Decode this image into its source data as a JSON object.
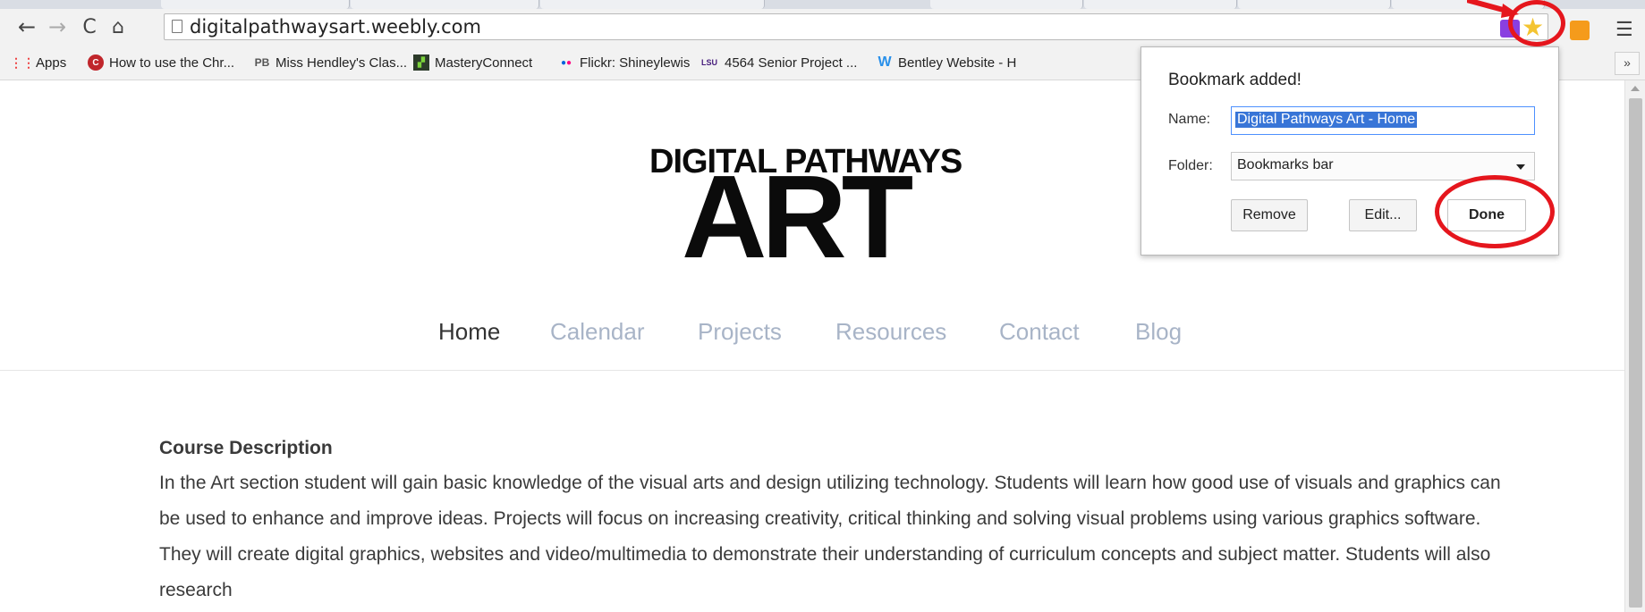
{
  "browser": {
    "url": "digitalpathwaysart.weebly.com",
    "bookmarks": [
      {
        "label": "Apps",
        "icon": "apps-grid-icon"
      },
      {
        "label": "How to use the Chr...",
        "icon": "red-circle-icon"
      },
      {
        "label": "Miss Hendley's Clas...",
        "icon": "PB"
      },
      {
        "label": "MasteryConnect",
        "icon": "masteryconnect-icon"
      },
      {
        "label": "Flickr: Shineylewis",
        "icon": "flickr-dots-icon"
      },
      {
        "label": "4564 Senior Project ...",
        "icon": "LSU"
      },
      {
        "label": "Bentley Website - H",
        "icon": "weebly-w-icon"
      }
    ],
    "bookmarks_more": "»"
  },
  "bookmark_popup": {
    "title": "Bookmark added!",
    "name_label": "Name:",
    "name_value": "Digital Pathways Art - Home",
    "folder_label": "Folder:",
    "folder_value": "Bookmarks bar",
    "remove_label": "Remove",
    "edit_label": "Edit...",
    "done_label": "Done"
  },
  "site": {
    "logo_line1": "DIGITAL PATHWAYS",
    "logo_line2": "ART",
    "nav": [
      "Home",
      "Calendar",
      "Projects",
      "Resources",
      "Contact",
      "Blog"
    ],
    "active_nav": "Home",
    "heading": "Course Description",
    "paragraph": "In the Art section student will gain basic knowledge of the visual arts and design utilizing technology. Students will learn how good use of visuals and graphics can be used to enhance and improve ideas. Projects will focus on increasing creativity, critical thinking and solving visual problems using various graphics software. They will create digital graphics, websites and video/multimedia to demonstrate their understanding of curriculum concepts and subject matter. Students will also research"
  },
  "colors": {
    "annotation_red": "#e5161d",
    "nav_inactive": "#a8b4c7",
    "star": "#f4c431"
  }
}
